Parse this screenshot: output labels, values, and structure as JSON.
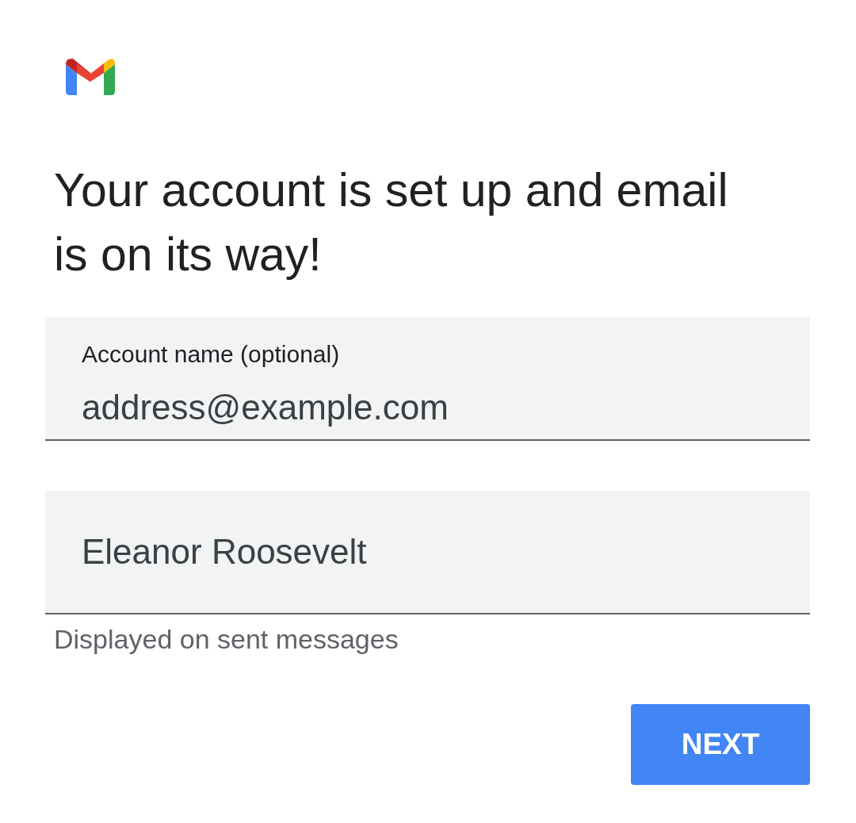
{
  "title": "Your account is set up and email is on its way!",
  "fields": [
    {
      "label": "Account name (optional)",
      "value": "address@example.com"
    },
    {
      "value": "Eleanor Roosevelt",
      "helper": "Displayed on sent messages"
    }
  ],
  "button": {
    "label": "NEXT"
  }
}
